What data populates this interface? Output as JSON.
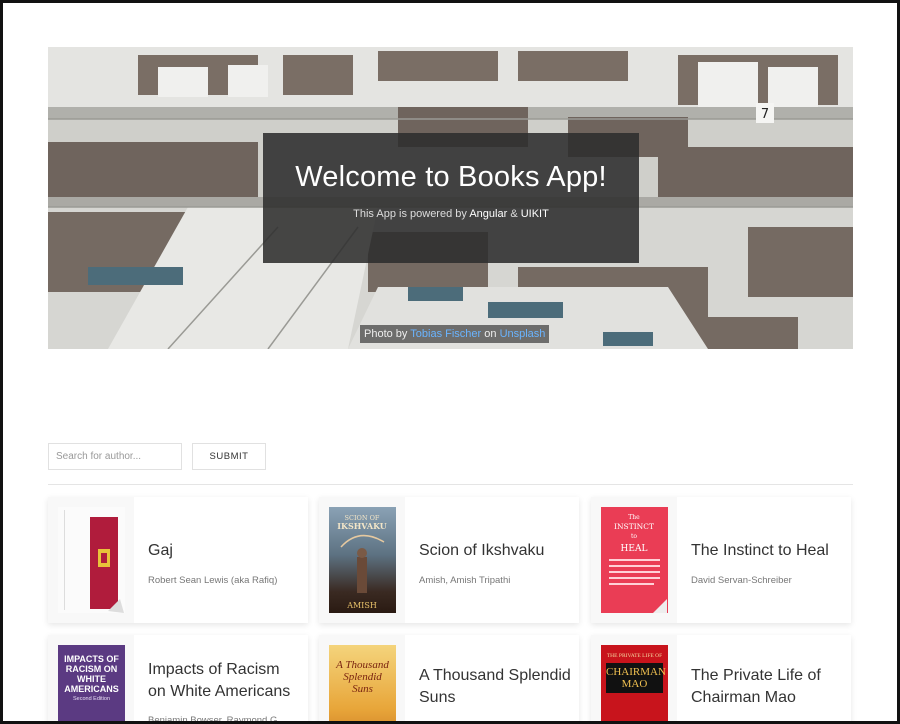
{
  "hero": {
    "title": "Welcome to Books App!",
    "subtitle_prefix": "This App is powered by ",
    "subtitle_tech1": "Angular",
    "subtitle_amp": " & ",
    "subtitle_tech2": "UIKIT",
    "credit_prefix": "Photo by ",
    "credit_author": "Tobias Fischer",
    "credit_mid": " on ",
    "credit_site": "Unsplash",
    "sign_number": "7"
  },
  "search": {
    "placeholder": "Search for author...",
    "value": "",
    "submit_label": "SUBMIT"
  },
  "books": [
    {
      "title": "Gaj",
      "author": "Robert Sean Lewis (aka Rafiq)"
    },
    {
      "title": "Scion of Ikshvaku",
      "author": "Amish, Amish Tripathi",
      "cover_top": "SCION OF",
      "cover_main": "IKSHVAKU",
      "cover_bottom": "AMISH"
    },
    {
      "title": "The Instinct to Heal",
      "author": "David Servan-Schreiber",
      "cover_top": "The",
      "cover_main1": "INSTINCT",
      "cover_mid": "to",
      "cover_main2": "HEAL"
    },
    {
      "title": "Impacts of Racism on White Americans",
      "author": "Benjamin Bowser, Raymond G.",
      "cover_main": "IMPACTS OF RACISM ON WHITE AMERICANS",
      "cover_edition": "Second Edition"
    },
    {
      "title": "A Thousand Splendid Suns",
      "author": "",
      "cover_main": "A Thousand Splendid Suns"
    },
    {
      "title": "The Private Life of Chairman Mao",
      "author": "",
      "cover_top": "THE PRIVATE LIFE OF",
      "cover_main": "CHAIRMAN MAO"
    }
  ],
  "colors": {
    "hero_overlay": "#2d2d2d",
    "link": "#6ab4ff",
    "card_shadow": "#e0e0e0"
  }
}
